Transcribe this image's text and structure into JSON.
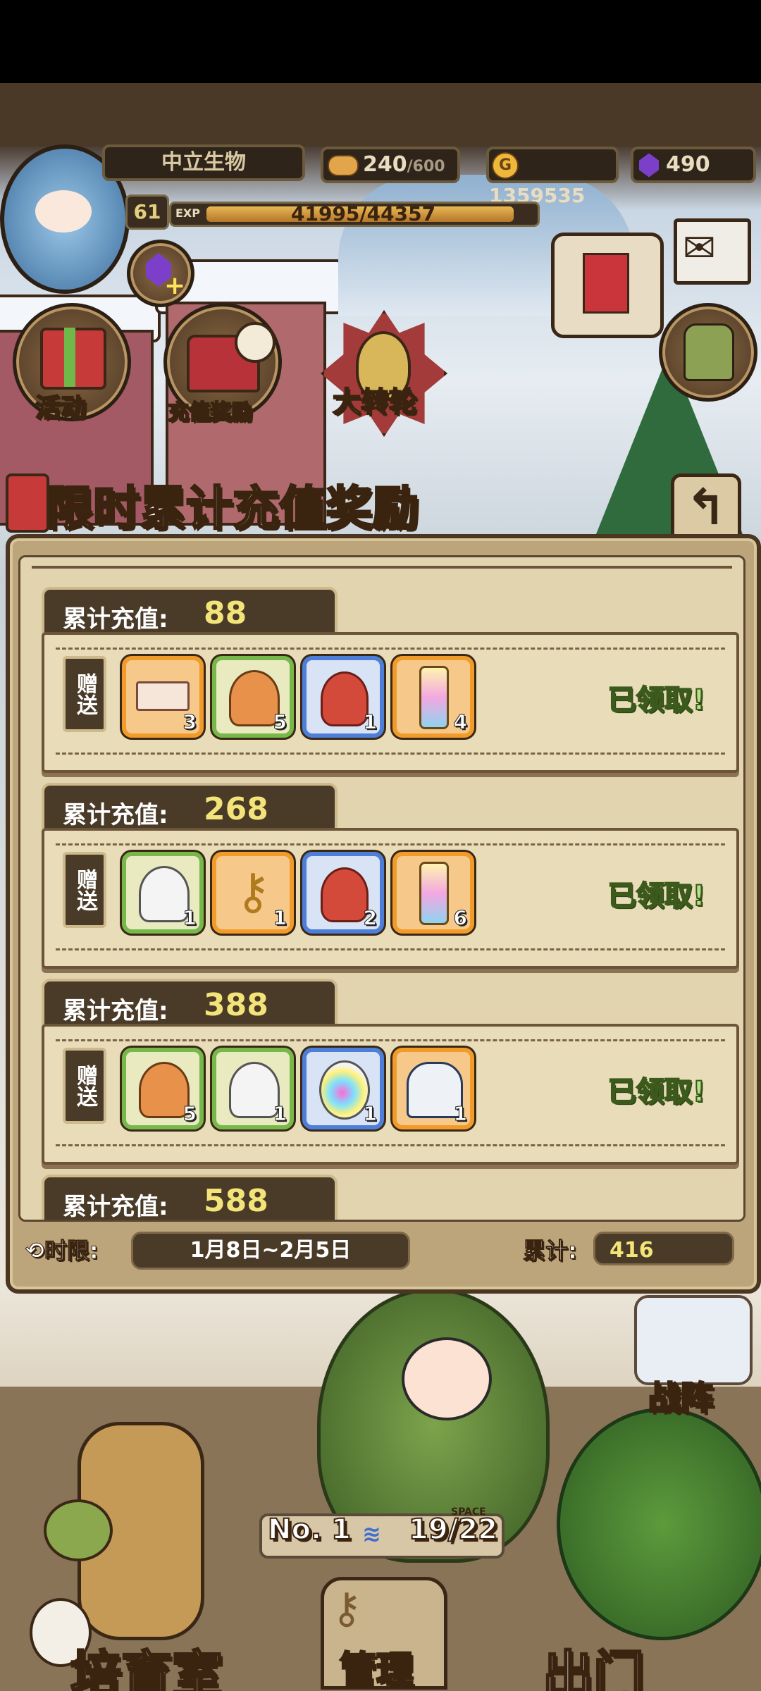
{
  "hud": {
    "zone_name": "中立生物",
    "level": "61",
    "exp_label": "EXP",
    "exp_text": "41995/44357",
    "exp_fraction": 0.947,
    "stamina_current": "240",
    "stamina_max": "/600",
    "gold": "1359535",
    "gems": "490"
  },
  "menu": {
    "activity": "活动",
    "recharge_reward": "充值奖励",
    "wheel": "大转轮"
  },
  "panel": {
    "title": "限时累计充值奖励",
    "tier_label": "累计充值:",
    "gift_label": "赠送",
    "claimed_label": "已领取!",
    "tiers": [
      {
        "amount": "88",
        "rewards": [
          {
            "icon": "ticket-icon",
            "border": "orange",
            "count": "3"
          },
          {
            "icon": "orange-slime-icon",
            "border": "green",
            "count": "5"
          },
          {
            "icon": "red-pudding-icon",
            "border": "blue",
            "count": "1"
          },
          {
            "icon": "potion-bottle-icon",
            "border": "orange",
            "count": "4"
          }
        ]
      },
      {
        "amount": "268",
        "rewards": [
          {
            "icon": "white-slime-icon",
            "border": "green",
            "count": "1"
          },
          {
            "icon": "golden-key-icon",
            "border": "orange",
            "count": "1"
          },
          {
            "icon": "red-pudding-icon",
            "border": "blue",
            "count": "2"
          },
          {
            "icon": "potion-bottle-icon",
            "border": "orange",
            "count": "6"
          }
        ]
      },
      {
        "amount": "388",
        "rewards": [
          {
            "icon": "orange-slime-icon",
            "border": "green",
            "count": "5"
          },
          {
            "icon": "white-slime-icon",
            "border": "green",
            "count": "1"
          },
          {
            "icon": "rainbow-egg-icon",
            "border": "blue",
            "count": "1"
          },
          {
            "icon": "white-cloak-icon",
            "border": "orange",
            "count": "1"
          }
        ]
      },
      {
        "amount": "588"
      }
    ],
    "time_label": "时限:",
    "time_range": "1月8日~2月5日",
    "total_label": "累计:",
    "total_value": "416"
  },
  "scene": {
    "formation": "战阵",
    "rank": "No. 1",
    "space_label": "SPACE",
    "space_value": "19/22"
  },
  "nav": {
    "nursery": "培育室",
    "manage": "管理",
    "exit": "出门"
  },
  "colors": {
    "panel_bg": "#bca57b",
    "tier_value": "#f3e47a",
    "claimed": "#b7e08a",
    "border_orange": "#f09b2a",
    "border_green": "#76b84a",
    "border_blue": "#4d7fd8"
  }
}
